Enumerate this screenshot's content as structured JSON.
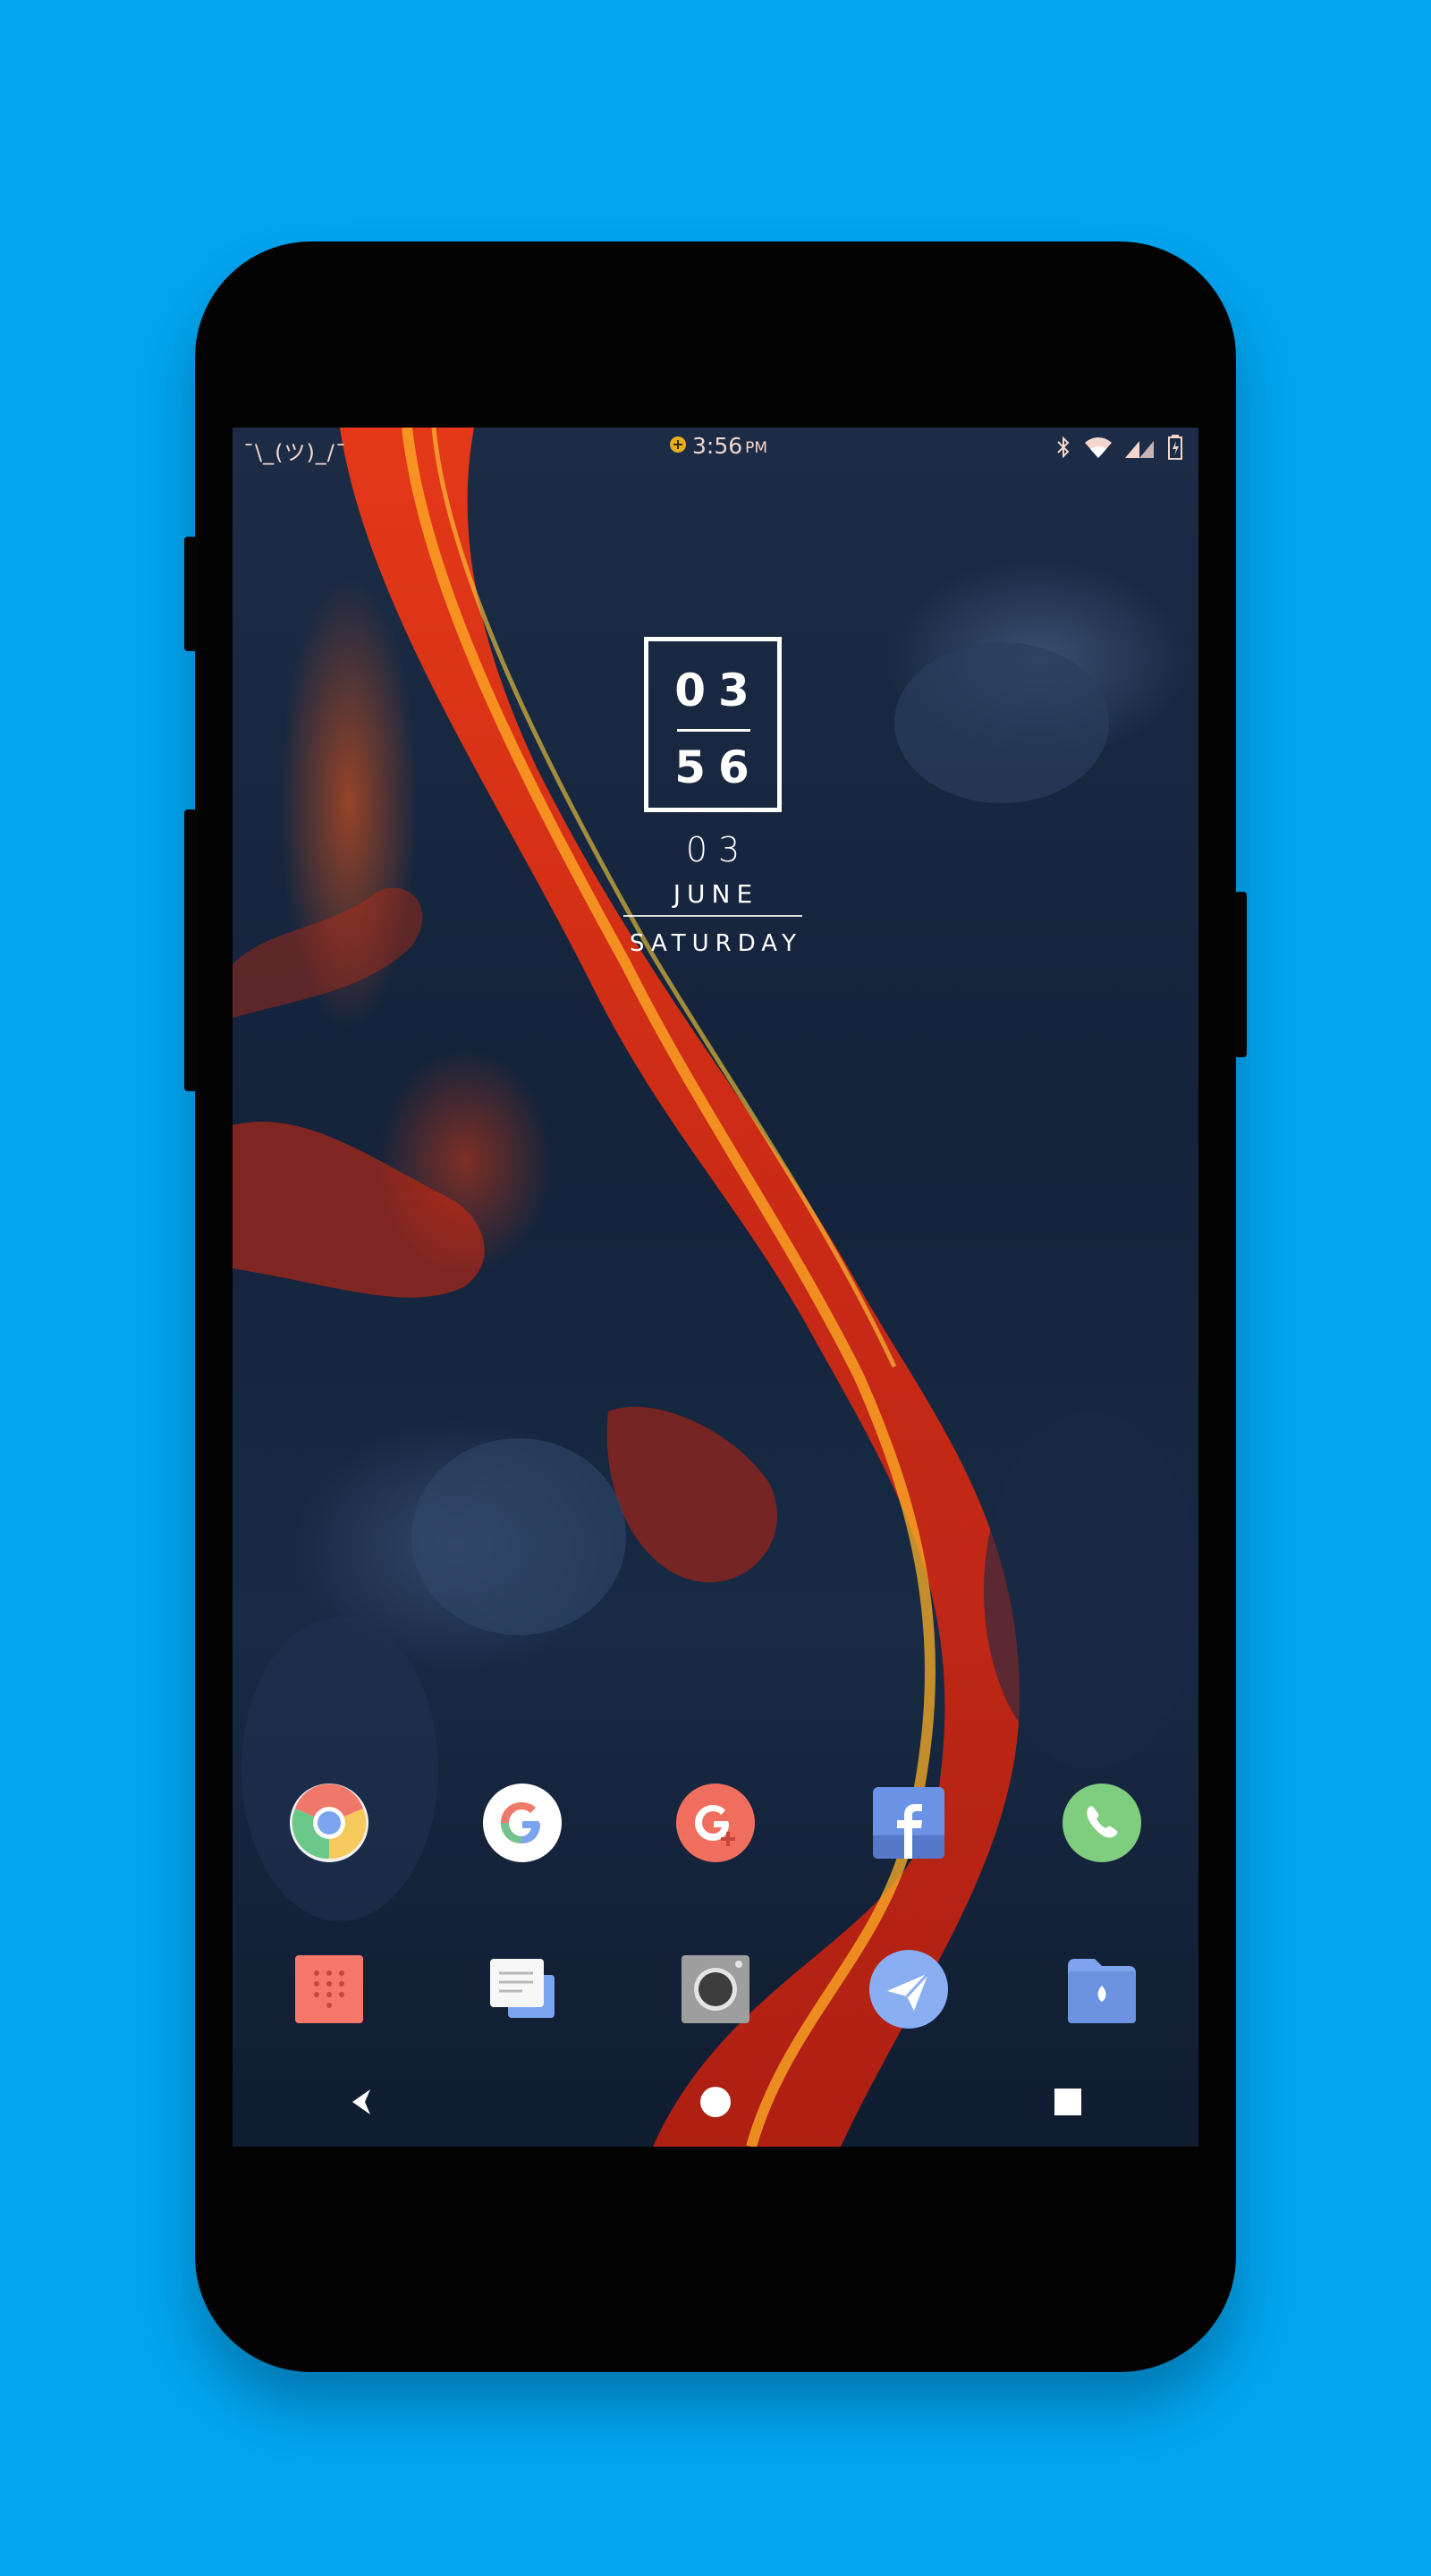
{
  "status_bar": {
    "left_text": "¯\\_(ツ)_/¯",
    "time": "3:56",
    "ampm": "PM",
    "icons": [
      "bluetooth-icon",
      "wifi-icon",
      "cell-signal-icon",
      "battery-icon"
    ]
  },
  "clock_widget": {
    "hours": "03",
    "minutes": "56",
    "day": "03",
    "month": "JUNE",
    "weekday": "SATURDAY"
  },
  "dock_row_1": [
    {
      "name": "Chrome",
      "icon": "chrome-icon"
    },
    {
      "name": "Google",
      "icon": "google-icon"
    },
    {
      "name": "Google+",
      "icon": "google-plus-icon"
    },
    {
      "name": "Facebook",
      "icon": "facebook-icon"
    },
    {
      "name": "WhatsApp",
      "icon": "whatsapp-icon"
    }
  ],
  "dock_row_2": [
    {
      "name": "Phone",
      "icon": "dialer-icon"
    },
    {
      "name": "Messages",
      "icon": "messages-icon"
    },
    {
      "name": "Camera",
      "icon": "camera-icon"
    },
    {
      "name": "Telegram",
      "icon": "telegram-icon"
    },
    {
      "name": "Files",
      "icon": "files-icon"
    }
  ],
  "nav_bar": [
    "back-icon",
    "home-icon",
    "recents-icon"
  ],
  "colors": {
    "background": "#02a4ef",
    "phone_body": "#030303",
    "lava": "#e8401a"
  }
}
